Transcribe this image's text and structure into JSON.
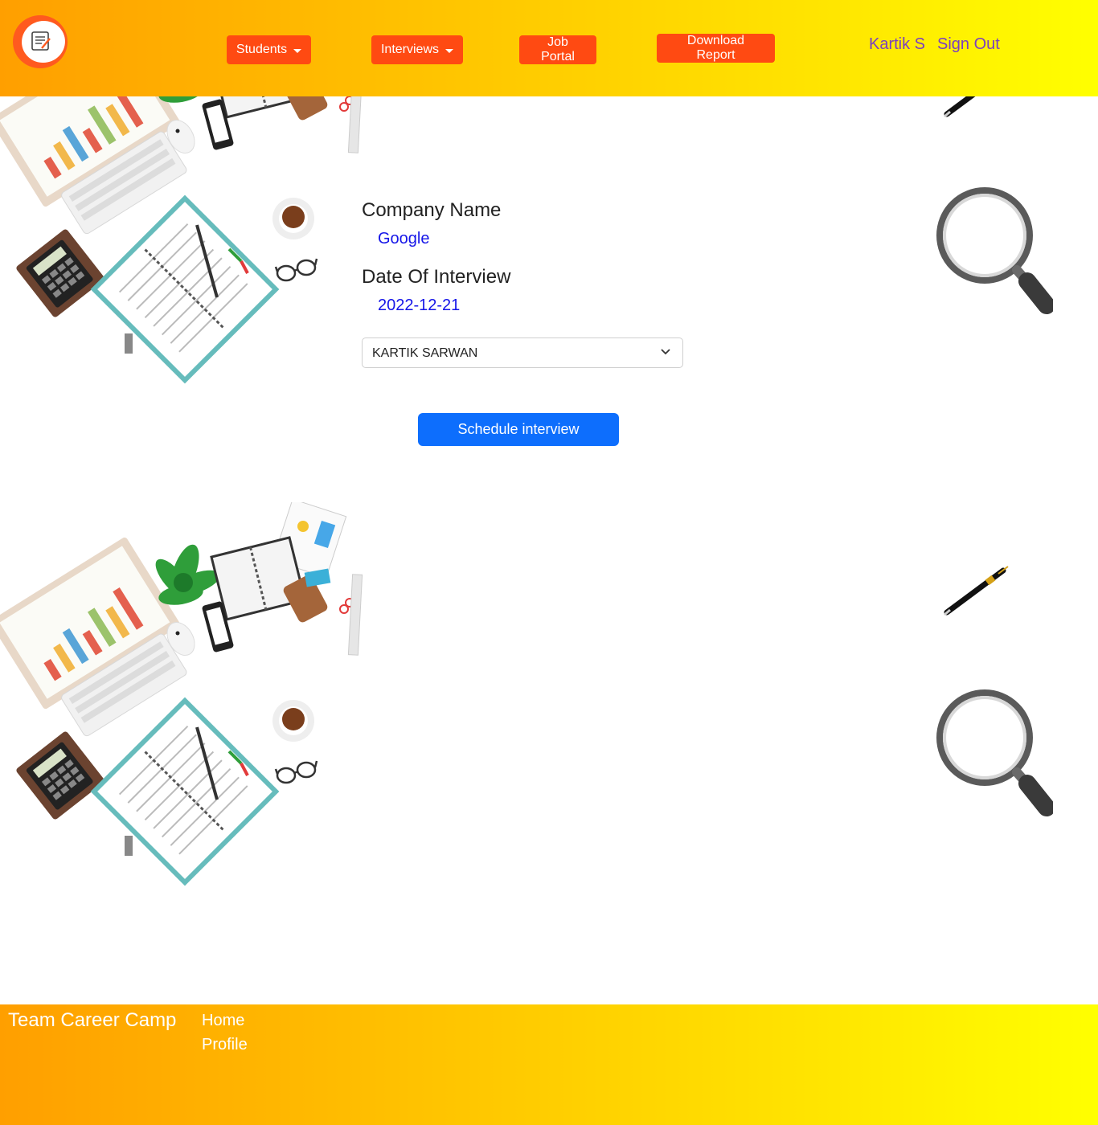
{
  "header": {
    "nav": {
      "students": "Students",
      "interviews": "Interviews",
      "job_portal": "Job Portal",
      "download_report": "Download Report"
    },
    "user_name": "Kartik S",
    "sign_out": "Sign Out"
  },
  "form": {
    "company_label": "Company Name",
    "company_value": "Google",
    "date_label": "Date Of Interview",
    "date_value": "2022-12-21",
    "student_select": {
      "selected": "KARTIK SARWAN",
      "options": [
        "KARTIK SARWAN"
      ]
    },
    "submit_label": "Schedule interview"
  },
  "footer": {
    "brand": "Team Career Camp",
    "links": [
      "Home",
      "Profile"
    ]
  },
  "colors": {
    "nav_button": "#ff4a12",
    "primary_button": "#0d6efd",
    "value_text": "#1515e8",
    "user_link": "#7b3fc0",
    "gradient_start": "#ff9f00",
    "gradient_end": "#ffff00"
  },
  "icons": {
    "logo": "resume-logo-icon",
    "dropdown": "chevron-down-icon"
  }
}
